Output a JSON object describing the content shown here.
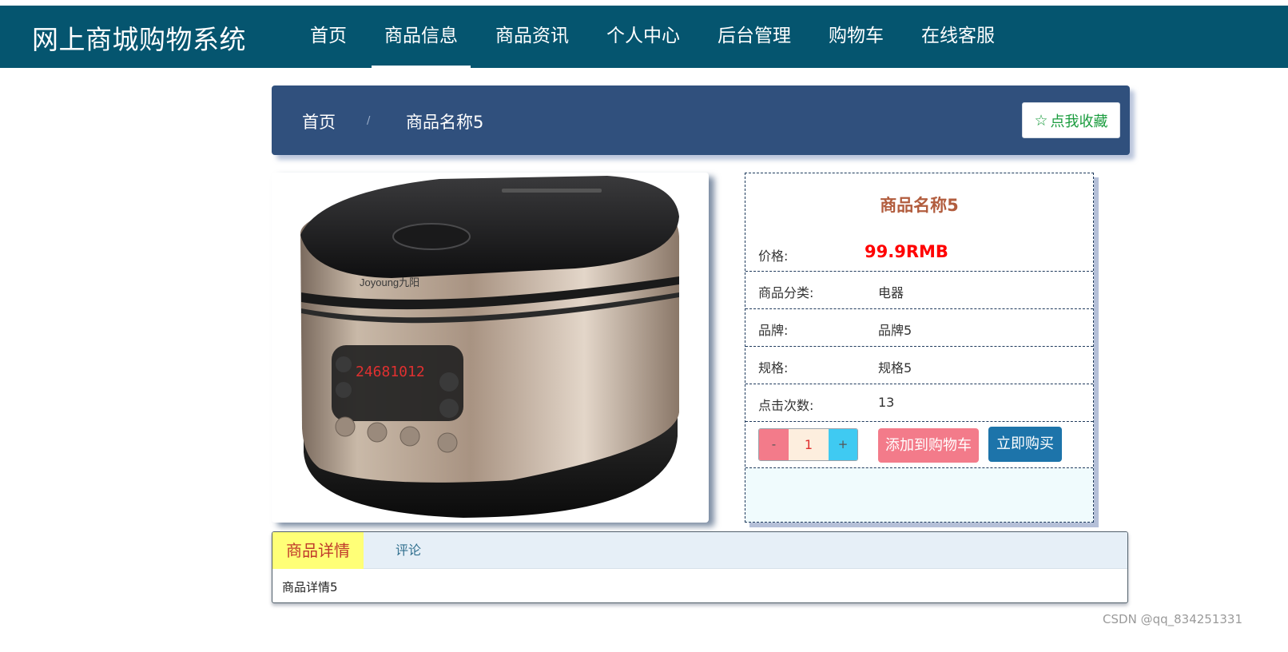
{
  "header": {
    "brand": "网上商城购物系统",
    "nav": [
      {
        "label": "首页",
        "active": false
      },
      {
        "label": "商品信息",
        "active": true
      },
      {
        "label": "商品资讯",
        "active": false
      },
      {
        "label": "个人中心",
        "active": false
      },
      {
        "label": "后台管理",
        "active": false
      },
      {
        "label": "购物车",
        "active": false
      },
      {
        "label": "在线客服",
        "active": false
      }
    ]
  },
  "breadcrumb": {
    "home": "首页",
    "separator": "/",
    "current": "商品名称5"
  },
  "favorite_button": {
    "icon": "star-outline-icon",
    "label": "点我收藏"
  },
  "product": {
    "title": "商品名称5",
    "fields": [
      {
        "key": "价格:",
        "value": "99.9RMB"
      },
      {
        "key": "商品分类:",
        "value": "电器"
      },
      {
        "key": "品牌:",
        "value": "品牌5"
      },
      {
        "key": "规格:",
        "value": "规格5"
      },
      {
        "key": "点击次数:",
        "value": "13"
      }
    ],
    "image_brand_text": "Joyoung九阳",
    "image_display_digits": "24681012",
    "quantity": {
      "minus": "-",
      "value": "1",
      "plus": "+"
    },
    "add_to_cart": "添加到购物车",
    "buy_now": "立即购买"
  },
  "tabs": {
    "items": [
      {
        "label": "商品详情",
        "active": true
      },
      {
        "label": "评论",
        "active": false
      }
    ],
    "content": "商品详情5"
  },
  "watermark": "CSDN @qq_834251331",
  "colors": {
    "header_bg": "#05556f",
    "breadcrumb_bg": "#30507d",
    "price_red": "#ff0000",
    "title_brown": "#b25d3e",
    "cart_pink": "#f37b8a",
    "buy_blue": "#1d74aa",
    "tab_active_yellow": "#ffff77"
  }
}
